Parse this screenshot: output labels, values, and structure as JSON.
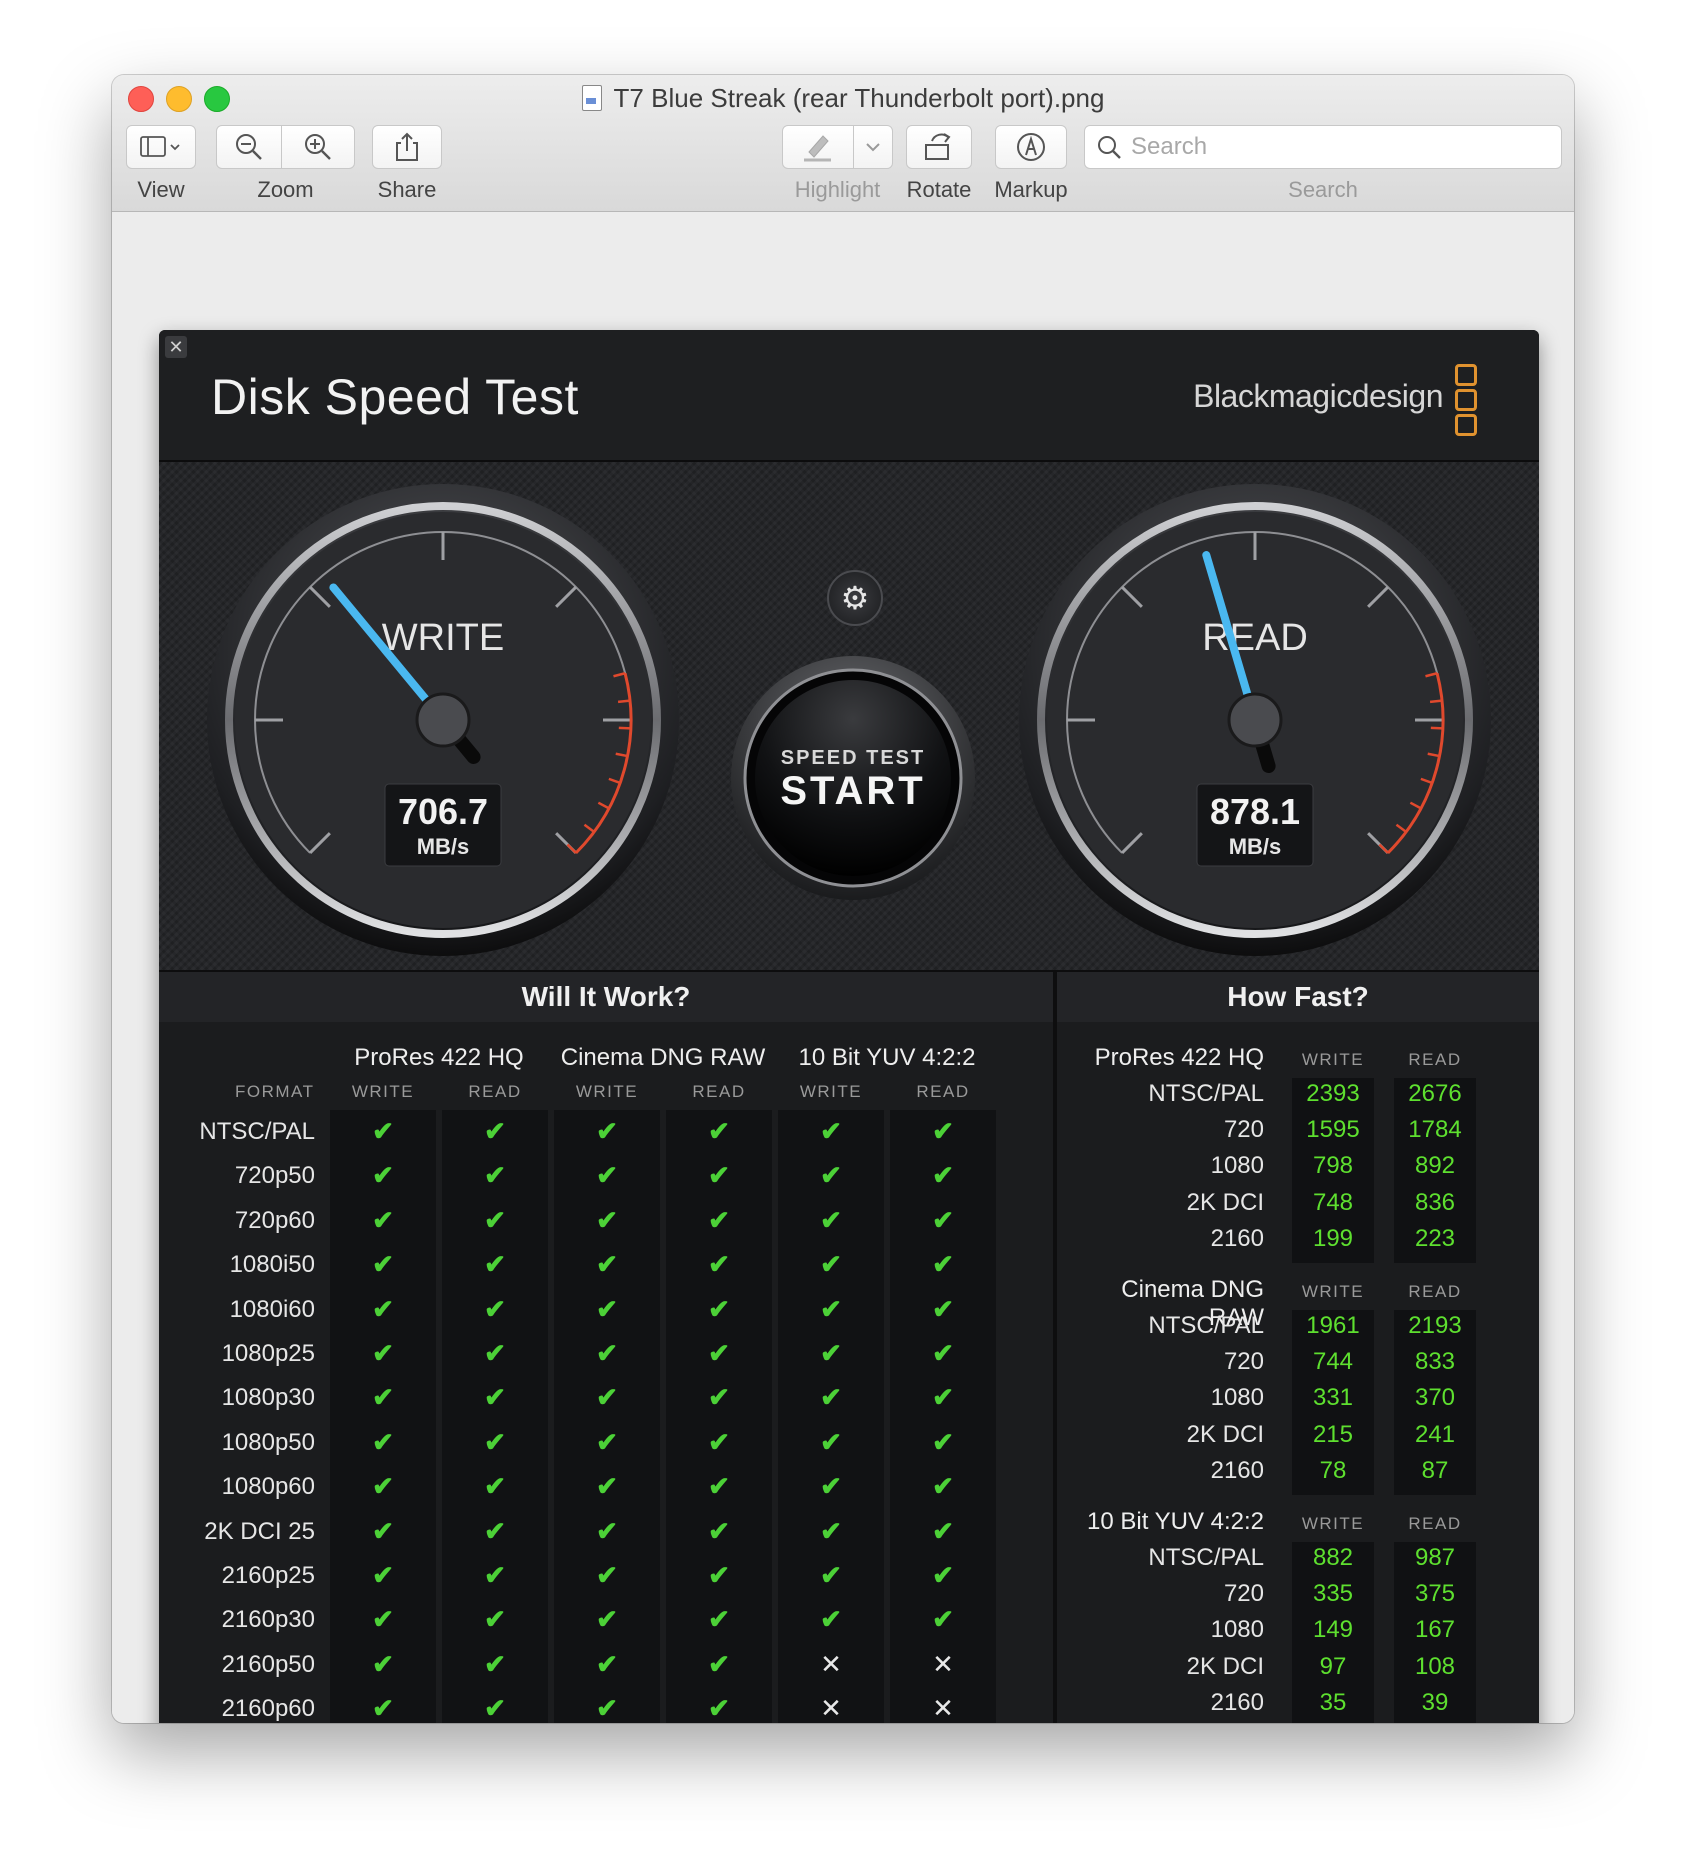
{
  "window": {
    "title": "T7 Blue Streak (rear Thunderbolt port).png"
  },
  "toolbar": {
    "view_label": "View",
    "zoom_label": "Zoom",
    "share_label": "Share",
    "highlight_label": "Highlight",
    "rotate_label": "Rotate",
    "markup_label": "Markup",
    "search_placeholder": "Search",
    "search_label": "Search"
  },
  "app": {
    "title": "Disk Speed Test",
    "brand": "Blackmagicdesign",
    "accent_color": "#4ab8f0",
    "ok_color": "#4cd137"
  },
  "gauges": {
    "write": {
      "label": "WRITE",
      "value": "706.7",
      "unit": "MB/s",
      "needle_value": 706.7
    },
    "read": {
      "label": "READ",
      "value": "878.1",
      "unit": "MB/s",
      "needle_value": 878.1
    },
    "scale_max": 2000
  },
  "start_button": {
    "top": "SPEED TEST",
    "main": "START"
  },
  "will_it_work": {
    "title": "Will It Work?",
    "format_header": "FORMAT",
    "groups": [
      "ProRes 422 HQ",
      "Cinema DNG RAW",
      "10 Bit YUV 4:2:2"
    ],
    "subheaders": [
      "WRITE",
      "READ"
    ],
    "rows": [
      {
        "label": "NTSC/PAL",
        "cells": [
          1,
          1,
          1,
          1,
          1,
          1
        ]
      },
      {
        "label": "720p50",
        "cells": [
          1,
          1,
          1,
          1,
          1,
          1
        ]
      },
      {
        "label": "720p60",
        "cells": [
          1,
          1,
          1,
          1,
          1,
          1
        ]
      },
      {
        "label": "1080i50",
        "cells": [
          1,
          1,
          1,
          1,
          1,
          1
        ]
      },
      {
        "label": "1080i60",
        "cells": [
          1,
          1,
          1,
          1,
          1,
          1
        ]
      },
      {
        "label": "1080p25",
        "cells": [
          1,
          1,
          1,
          1,
          1,
          1
        ]
      },
      {
        "label": "1080p30",
        "cells": [
          1,
          1,
          1,
          1,
          1,
          1
        ]
      },
      {
        "label": "1080p50",
        "cells": [
          1,
          1,
          1,
          1,
          1,
          1
        ]
      },
      {
        "label": "1080p60",
        "cells": [
          1,
          1,
          1,
          1,
          1,
          1
        ]
      },
      {
        "label": "2K DCI 25",
        "cells": [
          1,
          1,
          1,
          1,
          1,
          1
        ]
      },
      {
        "label": "2160p25",
        "cells": [
          1,
          1,
          1,
          1,
          1,
          1
        ]
      },
      {
        "label": "2160p30",
        "cells": [
          1,
          1,
          1,
          1,
          1,
          1
        ]
      },
      {
        "label": "2160p50",
        "cells": [
          1,
          1,
          1,
          1,
          0,
          0
        ]
      },
      {
        "label": "2160p60",
        "cells": [
          1,
          1,
          1,
          1,
          0,
          0
        ]
      }
    ]
  },
  "how_fast": {
    "title": "How Fast?",
    "groups": [
      {
        "name": "ProRes 422 HQ",
        "write_label": "WRITE",
        "read_label": "READ",
        "rows": [
          {
            "label": "NTSC/PAL",
            "write": "2393",
            "read": "2676"
          },
          {
            "label": "720",
            "write": "1595",
            "read": "1784"
          },
          {
            "label": "1080",
            "write": "798",
            "read": "892"
          },
          {
            "label": "2K DCI",
            "write": "748",
            "read": "836"
          },
          {
            "label": "2160",
            "write": "199",
            "read": "223"
          }
        ]
      },
      {
        "name": "Cinema DNG RAW",
        "write_label": "WRITE",
        "read_label": "READ",
        "rows": [
          {
            "label": "NTSC/PAL",
            "write": "1961",
            "read": "2193"
          },
          {
            "label": "720",
            "write": "744",
            "read": "833"
          },
          {
            "label": "1080",
            "write": "331",
            "read": "370"
          },
          {
            "label": "2K DCI",
            "write": "215",
            "read": "241"
          },
          {
            "label": "2160",
            "write": "78",
            "read": "87"
          }
        ]
      },
      {
        "name": "10 Bit YUV 4:2:2",
        "write_label": "WRITE",
        "read_label": "READ",
        "rows": [
          {
            "label": "NTSC/PAL",
            "write": "882",
            "read": "987"
          },
          {
            "label": "720",
            "write": "335",
            "read": "375"
          },
          {
            "label": "1080",
            "write": "149",
            "read": "167"
          },
          {
            "label": "2K DCI",
            "write": "97",
            "read": "108"
          },
          {
            "label": "2160",
            "write": "35",
            "read": "39"
          }
        ]
      }
    ]
  }
}
